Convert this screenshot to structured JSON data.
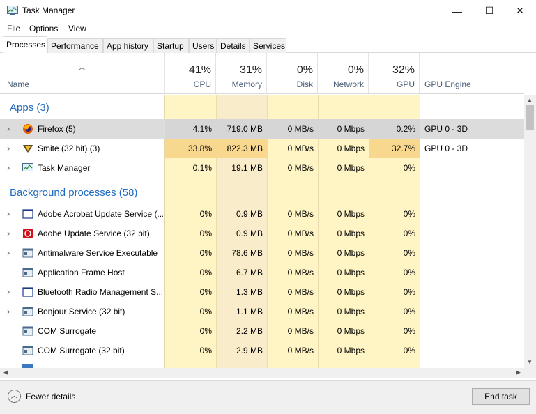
{
  "window": {
    "title": "Task Manager",
    "min": "—",
    "max": "☐",
    "close": "✕"
  },
  "menu": [
    "File",
    "Options",
    "View"
  ],
  "tabs": [
    "Processes",
    "Performance",
    "App history",
    "Startup",
    "Users",
    "Details",
    "Services"
  ],
  "columns": {
    "name": "Name",
    "cpu": {
      "pct": "41%",
      "label": "CPU"
    },
    "memory": {
      "pct": "31%",
      "label": "Memory"
    },
    "disk": {
      "pct": "0%",
      "label": "Disk"
    },
    "network": {
      "pct": "0%",
      "label": "Network"
    },
    "gpu": {
      "pct": "32%",
      "label": "GPU"
    },
    "gpu_engine": "GPU Engine"
  },
  "groups": {
    "apps": "Apps (3)",
    "background": "Background processes (58)"
  },
  "apps": [
    {
      "name": "Firefox (5)",
      "cpu": "4.1%",
      "memory": "719.0 MB",
      "disk": "0 MB/s",
      "network": "0 Mbps",
      "gpu": "0.2%",
      "engine": "GPU 0 - 3D",
      "icon": "firefox-icon"
    },
    {
      "name": "Smite (32 bit) (3)",
      "cpu": "33.8%",
      "memory": "822.3 MB",
      "disk": "0 MB/s",
      "network": "0 Mbps",
      "gpu": "32.7%",
      "engine": "GPU 0 - 3D",
      "icon": "smite-icon"
    },
    {
      "name": "Task Manager",
      "cpu": "0.1%",
      "memory": "19.1 MB",
      "disk": "0 MB/s",
      "network": "0 Mbps",
      "gpu": "0%",
      "engine": "",
      "icon": "task-manager-icon"
    }
  ],
  "background": [
    {
      "name": "Adobe Acrobat Update Service (...",
      "cpu": "0%",
      "memory": "0.9 MB",
      "disk": "0 MB/s",
      "network": "0 Mbps",
      "gpu": "0%",
      "icon": "window-icon"
    },
    {
      "name": "Adobe Update Service (32 bit)",
      "cpu": "0%",
      "memory": "0.9 MB",
      "disk": "0 MB/s",
      "network": "0 Mbps",
      "gpu": "0%",
      "icon": "adobe-icon"
    },
    {
      "name": "Antimalware Service Executable",
      "cpu": "0%",
      "memory": "78.6 MB",
      "disk": "0 MB/s",
      "network": "0 Mbps",
      "gpu": "0%",
      "icon": "service-icon"
    },
    {
      "name": "Application Frame Host",
      "cpu": "0%",
      "memory": "6.7 MB",
      "disk": "0 MB/s",
      "network": "0 Mbps",
      "gpu": "0%",
      "icon": "service-icon"
    },
    {
      "name": "Bluetooth Radio Management S...",
      "cpu": "0%",
      "memory": "1.3 MB",
      "disk": "0 MB/s",
      "network": "0 Mbps",
      "gpu": "0%",
      "icon": "window-icon"
    },
    {
      "name": "Bonjour Service (32 bit)",
      "cpu": "0%",
      "memory": "1.1 MB",
      "disk": "0 MB/s",
      "network": "0 Mbps",
      "gpu": "0%",
      "icon": "service-icon"
    },
    {
      "name": "COM Surrogate",
      "cpu": "0%",
      "memory": "2.2 MB",
      "disk": "0 MB/s",
      "network": "0 Mbps",
      "gpu": "0%",
      "icon": "service-icon"
    },
    {
      "name": "COM Surrogate (32 bit)",
      "cpu": "0%",
      "memory": "2.9 MB",
      "disk": "0 MB/s",
      "network": "0 Mbps",
      "gpu": "0%",
      "icon": "service-icon"
    }
  ],
  "footer": {
    "fewer_details": "Fewer details",
    "end_task": "End task"
  },
  "colors": {
    "heat_low": "#fff4c4",
    "heat_mid": "#f9eccb",
    "heat_high": "#f8d78e",
    "group_title": "#1f6cc0",
    "selected": "#dcdcdc"
  }
}
